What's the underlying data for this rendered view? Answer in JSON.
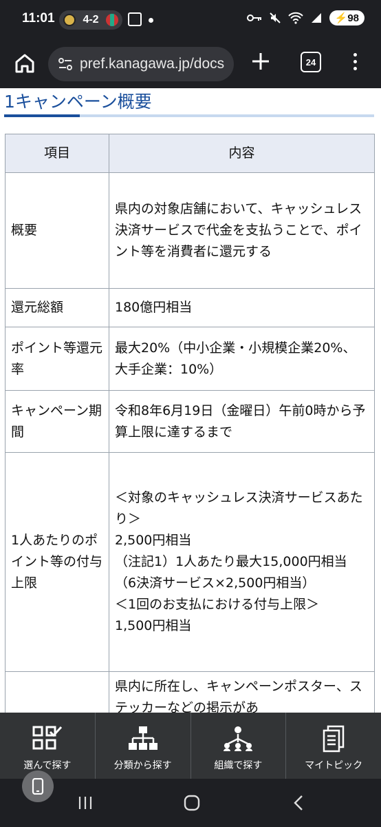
{
  "status_bar": {
    "time": "11:01",
    "score": "4-2",
    "battery": "98"
  },
  "browser": {
    "url": "pref.kanagawa.jp/docs",
    "tab_count": "24"
  },
  "section": {
    "title": "1キャンペーン概要"
  },
  "table": {
    "headers": [
      "項目",
      "内容"
    ],
    "rows": [
      {
        "key": "概要",
        "value": "県内の対象店舗において、キャッシュレス決済サービスで代金を支払うことで、ポイント等を消費者に還元する"
      },
      {
        "key": "還元総額",
        "value": "180億円相当"
      },
      {
        "key": "ポイント等還元率",
        "value": "最大20%（中小企業・小規模企業20%、大手企業：10%）"
      },
      {
        "key": "キャンペーン期間",
        "value": "令和8年6月19日（金曜日）午前0時から予算上限に達するまで"
      },
      {
        "key": "1人あたりのポイント等の付与上限",
        "value": "＜対象のキャッシュレス決済サービスあたり＞\n2,500円相当\n（注記1）1人あたり最大15,000円相当（6決済サービス×2,500円相当）\n＜1回のお支払における付与上限＞\n1,500円相当"
      },
      {
        "key": "",
        "value": "県内に所在し、キャンペーンポスター、ステッカーなどの掲示があ"
      }
    ]
  },
  "bottom_nav": [
    {
      "label": "選んで探す",
      "icon": "checklist-icon"
    },
    {
      "label": "分類から探す",
      "icon": "hierarchy-icon"
    },
    {
      "label": "組織で探す",
      "icon": "organization-icon"
    },
    {
      "label": "マイトピック",
      "icon": "document-icon"
    }
  ]
}
